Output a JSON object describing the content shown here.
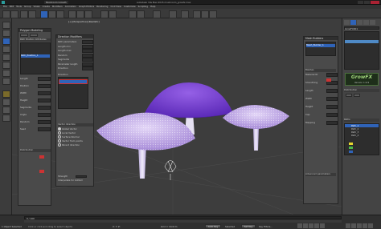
{
  "window": {
    "title": "Mushroom Growth",
    "document": "Autodesk 3ds Max 2015  mushroom_growfx.max"
  },
  "menubar": {
    "items": [
      "File",
      "Edit",
      "Tools",
      "Group",
      "Views",
      "Create",
      "Modifiers",
      "Animation",
      "Graph Editors",
      "Rendering",
      "Civil View",
      "Customize",
      "Scripting",
      "Help"
    ]
  },
  "left_panel": {
    "title": "Polygon Modeling",
    "sections": [
      "Path Position Attributes",
      "Distribution"
    ],
    "fields": [
      "Length",
      "Position",
      "Width",
      "Height",
      "Segments",
      "Angle",
      "Random",
      "Seed"
    ],
    "selected_item": "Path_Position_1"
  },
  "modifier_panel": {
    "title": "Direction Modifiers",
    "labels": [
      "Path parameters",
      "Length min",
      "Length max",
      "Random",
      "Segments",
      "Parameter length",
      "Direction"
    ],
    "list_title": "Direction",
    "bottom_section": "Vector direction",
    "options": [
      "Global Vector",
      "Local Vector",
      "Surface Normal",
      "Vector from points",
      "Parent direction"
    ],
    "bottom_labels": [
      "Strength",
      "Interpolate for bottom"
    ]
  },
  "viewport": {
    "label": "[+] [Perspective] [Realistic]"
  },
  "mesh_panel": {
    "title": "Mesh Builders",
    "items": [
      "Mesh_Builder_1"
    ],
    "section": "Meshes",
    "fields": [
      "Material ID",
      "Smoothing",
      "Length",
      "Width",
      "Height",
      "Cap",
      "Mapping"
    ],
    "section2": "Advanced parameters"
  },
  "right_panel": {
    "object_name": "GrowFX001",
    "brand": "GrowFX",
    "version": "Version 1.9.9",
    "section": "Distribution",
    "section2": "Paths",
    "list_items": [
      "Path_1",
      "Path_2",
      "Path_3",
      "Path_4"
    ]
  },
  "statusbar": {
    "selection": "1 Object Selected",
    "hint": "Click or click-and-drag to select objects",
    "frame": "0 / 100",
    "coords": "X:  Y:  Z:",
    "grid": "Grid = 10,0cm",
    "autokey": "Auto Key",
    "selected": "Selected",
    "setkey": "Set Key",
    "filters": "Key Filters..."
  },
  "colors": {
    "accent": "#2f63b8",
    "cap": "#a67fd9",
    "stem": "#d9d2ef",
    "violet": "#7a45d6",
    "highlight": "#c33"
  }
}
